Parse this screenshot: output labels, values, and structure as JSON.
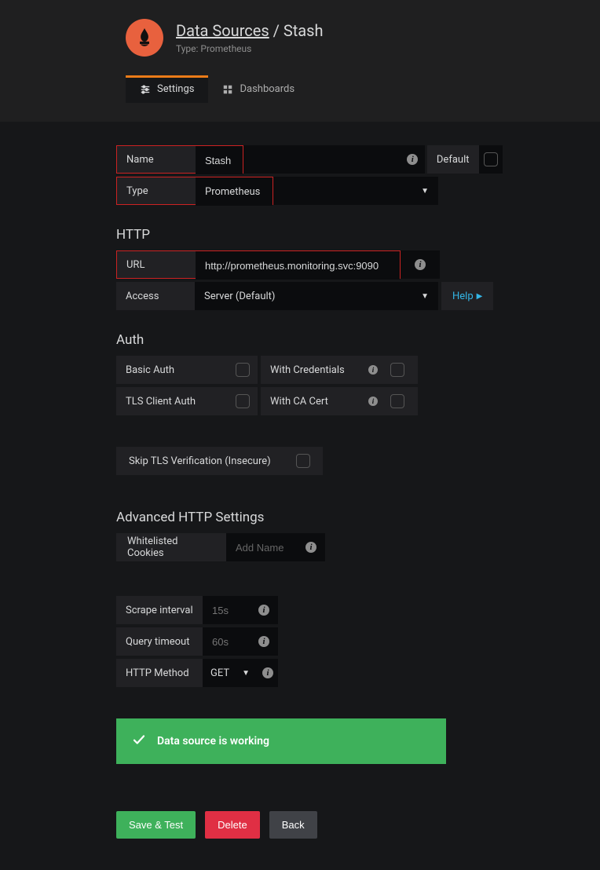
{
  "header": {
    "breadcrumb_link": "Data Sources",
    "breadcrumb_sep": " / ",
    "breadcrumb_current": "Stash",
    "subtitle": "Type: Prometheus"
  },
  "tabs": {
    "settings": "Settings",
    "dashboards": "Dashboards"
  },
  "form": {
    "name_label": "Name",
    "name_value": "Stash",
    "default_label": "Default",
    "type_label": "Type",
    "type_value": "Prometheus"
  },
  "http": {
    "section": "HTTP",
    "url_label": "URL",
    "url_value": "http://prometheus.monitoring.svc:9090",
    "access_label": "Access",
    "access_value": "Server (Default)",
    "help_label": "Help"
  },
  "auth": {
    "section": "Auth",
    "basic": "Basic Auth",
    "with_credentials": "With Credentials",
    "tls_client": "TLS Client Auth",
    "with_ca": "With CA Cert",
    "skip_tls": "Skip TLS Verification (Insecure)"
  },
  "advanced": {
    "section": "Advanced HTTP Settings",
    "whitelisted_label": "Whitelisted Cookies",
    "whitelisted_placeholder": "Add Name",
    "scrape_label": "Scrape interval",
    "scrape_placeholder": "15s",
    "timeout_label": "Query timeout",
    "timeout_placeholder": "60s",
    "method_label": "HTTP Method",
    "method_value": "GET"
  },
  "alert": {
    "message": "Data source is working"
  },
  "buttons": {
    "save": "Save & Test",
    "delete": "Delete",
    "back": "Back"
  }
}
